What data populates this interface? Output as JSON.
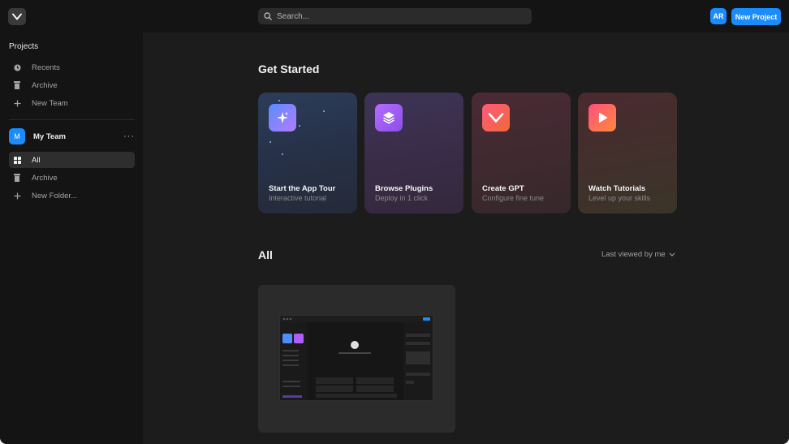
{
  "topbar": {
    "logo_icon": "v-logo-icon",
    "search_icon": "search-icon",
    "search_placeholder": "Search...",
    "avatar_initials": "AR",
    "new_project_label": "New Project",
    "accent_color": "#1a8cff"
  },
  "sidebar": {
    "heading": "Projects",
    "items": [
      {
        "label": "Recents",
        "icon": "clock-icon"
      },
      {
        "label": "Archive",
        "icon": "trash-icon"
      },
      {
        "label": "New Team",
        "icon": "plus-icon"
      }
    ],
    "team": {
      "avatar": "M",
      "name": "My Team",
      "more": "···",
      "items": [
        {
          "label": "All",
          "icon": "grid-icon",
          "active": true
        },
        {
          "label": "Archive",
          "icon": "trash-icon"
        },
        {
          "label": "New Folder...",
          "icon": "plus-icon"
        }
      ]
    }
  },
  "main": {
    "get_started_title": "Get Started",
    "cards": [
      {
        "title": "Start the App Tour",
        "subtitle": "Interactive tutorial",
        "icon": "sparkle-icon"
      },
      {
        "title": "Browse Plugins",
        "subtitle": "Deploy in 1 click",
        "icon": "layers-icon"
      },
      {
        "title": "Create GPT",
        "subtitle": "Configure fine tune",
        "icon": "v-logo-icon"
      },
      {
        "title": "Watch Tutorials",
        "subtitle": "Level up your skills",
        "icon": "play-icon"
      }
    ],
    "all_title": "All",
    "sort_label": "Last viewed by me",
    "sort_icon": "chevron-down-icon"
  }
}
